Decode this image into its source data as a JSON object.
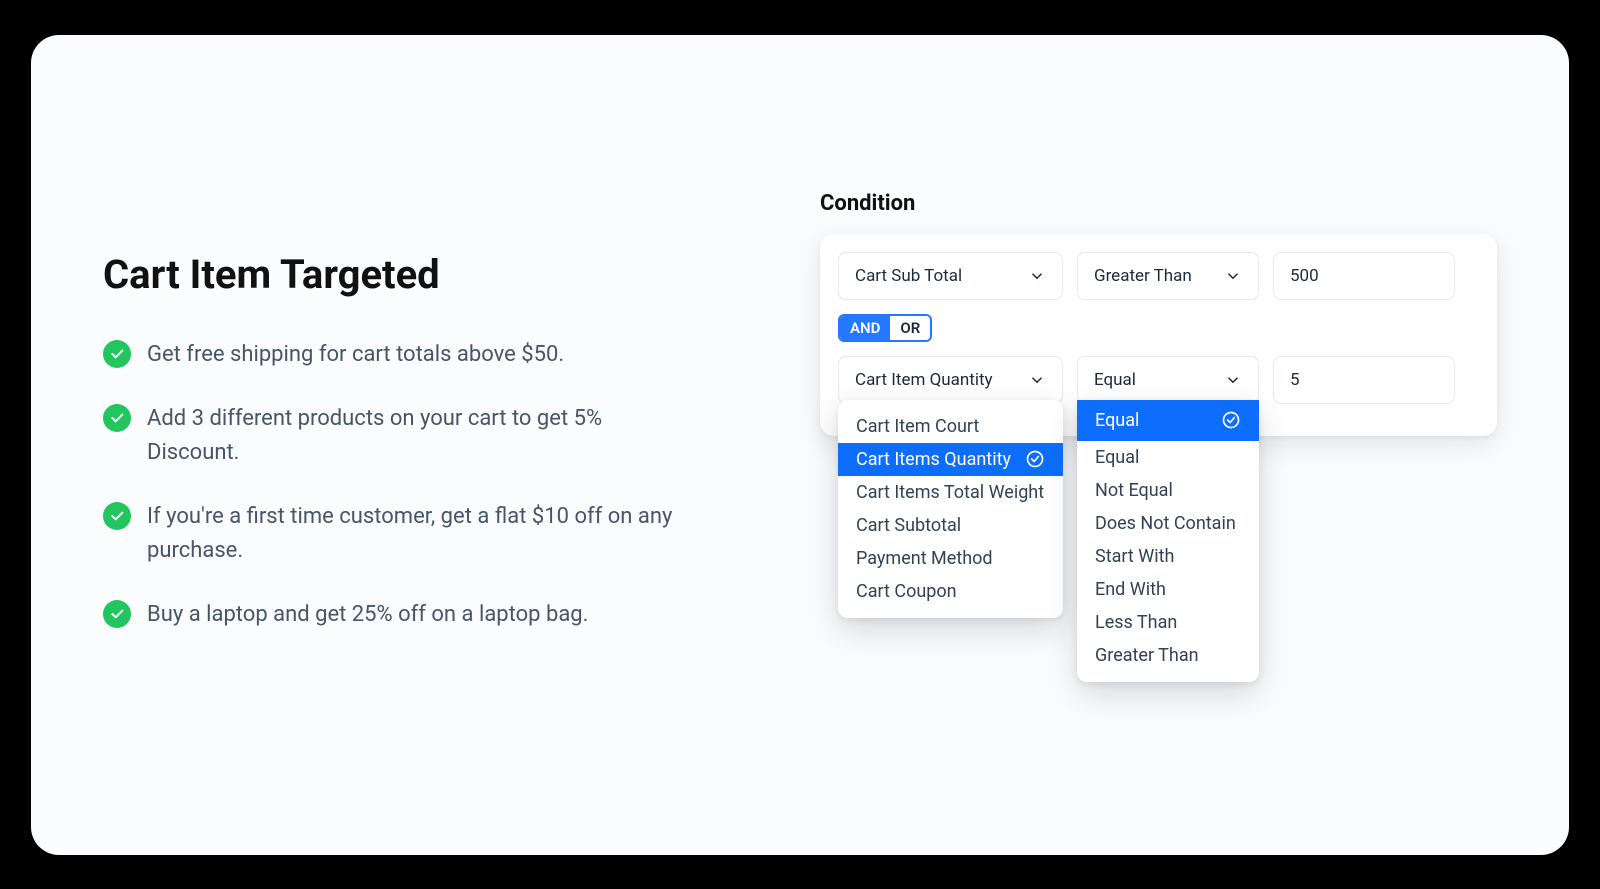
{
  "title": "Cart Item Targeted",
  "benefits": [
    "Get free shipping for cart totals above $50.",
    "Add 3 different products on your cart to get 5% Discount.",
    "If you're a first time customer, get a flat $10 off on any purchase.",
    "Buy a laptop and get 25% off on a laptop bag."
  ],
  "condition": {
    "label": "Condition",
    "rows": [
      {
        "attribute": "Cart Sub Total",
        "operator": "Greater Than",
        "value": "500"
      },
      {
        "attribute": "Cart Item Quantity",
        "operator": "Equal",
        "value": "5"
      }
    ],
    "logic": {
      "and": "AND",
      "or": "OR",
      "active": "AND"
    },
    "attributeOptions": [
      "Cart Item Court",
      "Cart Items Quantity",
      "Cart Items Total Weight",
      "Cart Subtotal",
      "Payment Method",
      "Cart Coupon"
    ],
    "attributeSelectedIndex": 1,
    "operatorOptions": [
      "Equal",
      "Equal",
      "Not Equal",
      "Does Not Contain",
      "Start With",
      "End With",
      "Less Than",
      "Greater Than"
    ],
    "operatorSelectedIndex": 0
  }
}
